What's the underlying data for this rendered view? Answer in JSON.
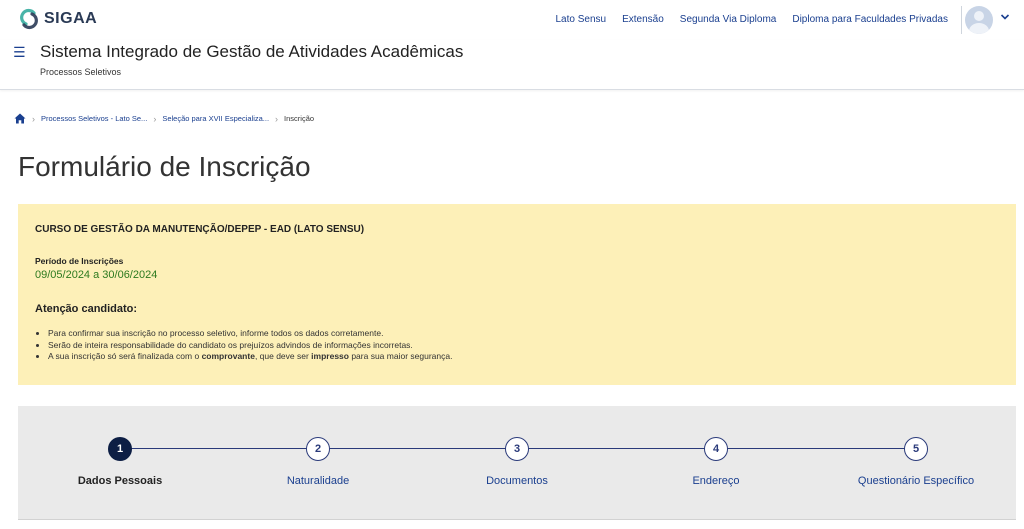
{
  "brand": {
    "name": "SIGAA",
    "color": "#2a3a55",
    "accent": "#49b4a8"
  },
  "topnav": [
    {
      "label": "Lato Sensu"
    },
    {
      "label": "Extensão"
    },
    {
      "label": "Segunda Via Diploma"
    },
    {
      "label": "Diploma para Faculdades Privadas"
    }
  ],
  "user": {
    "avatar_icon": "user-avatar-icon",
    "menu_icon": "chevron-down-icon"
  },
  "system": {
    "menu_icon": "hamburger-icon",
    "title": "Sistema Integrado de Gestão de Atividades Acadêmicas",
    "subtitle": "Processos Seletivos"
  },
  "breadcrumb": {
    "home_icon": "home-icon",
    "items": [
      {
        "label": "Processos Seletivos - Lato Se..."
      },
      {
        "label": "Seleção para XVII Especializa..."
      },
      {
        "label": "Inscrição"
      }
    ]
  },
  "page": {
    "title": "Formulário de Inscrição"
  },
  "notice": {
    "course": "CURSO DE GESTÃO DA MANUTENÇÃO/DEPEP - EAD (LATO SENSU)",
    "period_label": "Período de Inscrições",
    "period_value": "09/05/2024 a 30/06/2024",
    "attention_title": "Atenção candidato:",
    "items": [
      {
        "text": "Para confirmar sua inscrição no processo seletivo, informe todos os dados corretamente."
      },
      {
        "text": "Serão de inteira responsabilidade do candidato os prejuízos advindos de informações incorretas."
      },
      {
        "before": "A sua inscrição só será finalizada com o ",
        "bold1": "comprovante",
        "middle": ", que deve ser ",
        "bold2": "impresso",
        "after": " para sua maior segurança."
      }
    ],
    "background": "#fdf0b8"
  },
  "stepper": {
    "active_step": 1,
    "steps": [
      {
        "number": "1",
        "label": "Dados Pessoais"
      },
      {
        "number": "2",
        "label": "Naturalidade"
      },
      {
        "number": "3",
        "label": "Documentos"
      },
      {
        "number": "4",
        "label": "Endereço"
      },
      {
        "number": "5",
        "label": "Questionário Específico"
      }
    ],
    "active_color": "#0d1e44",
    "line_color": "#2a3a7a"
  }
}
